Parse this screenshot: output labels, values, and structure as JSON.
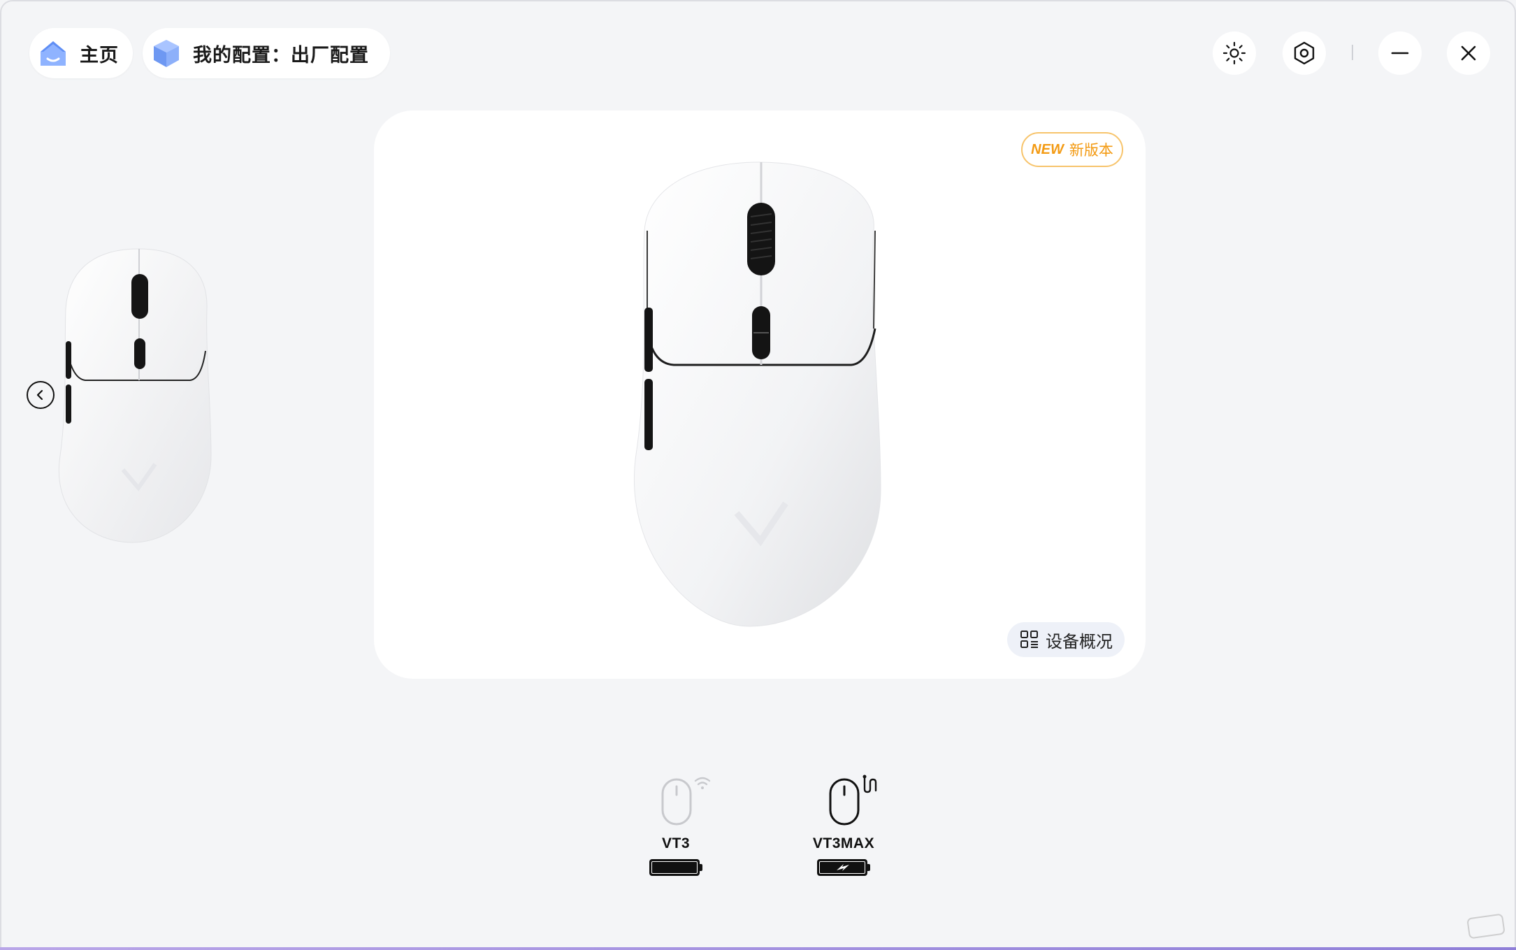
{
  "nav": {
    "home_label": "主页",
    "config_label": "我的配置：出厂配置"
  },
  "controls": {
    "icons": [
      "brightness-icon",
      "settings-icon",
      "minimize-icon",
      "close-icon"
    ]
  },
  "card": {
    "badge_new": "NEW",
    "badge_text": "新版本",
    "overview_label": "设备概况"
  },
  "devices": [
    {
      "name": "VT3",
      "connection": "wireless",
      "battery": "full"
    },
    {
      "name": "VT3MAX",
      "connection": "wired",
      "battery": "charging"
    }
  ],
  "colors": {
    "accent_blue": "#7aa7ff",
    "badge_orange": "#f39a12",
    "background": "#f4f5f7"
  }
}
